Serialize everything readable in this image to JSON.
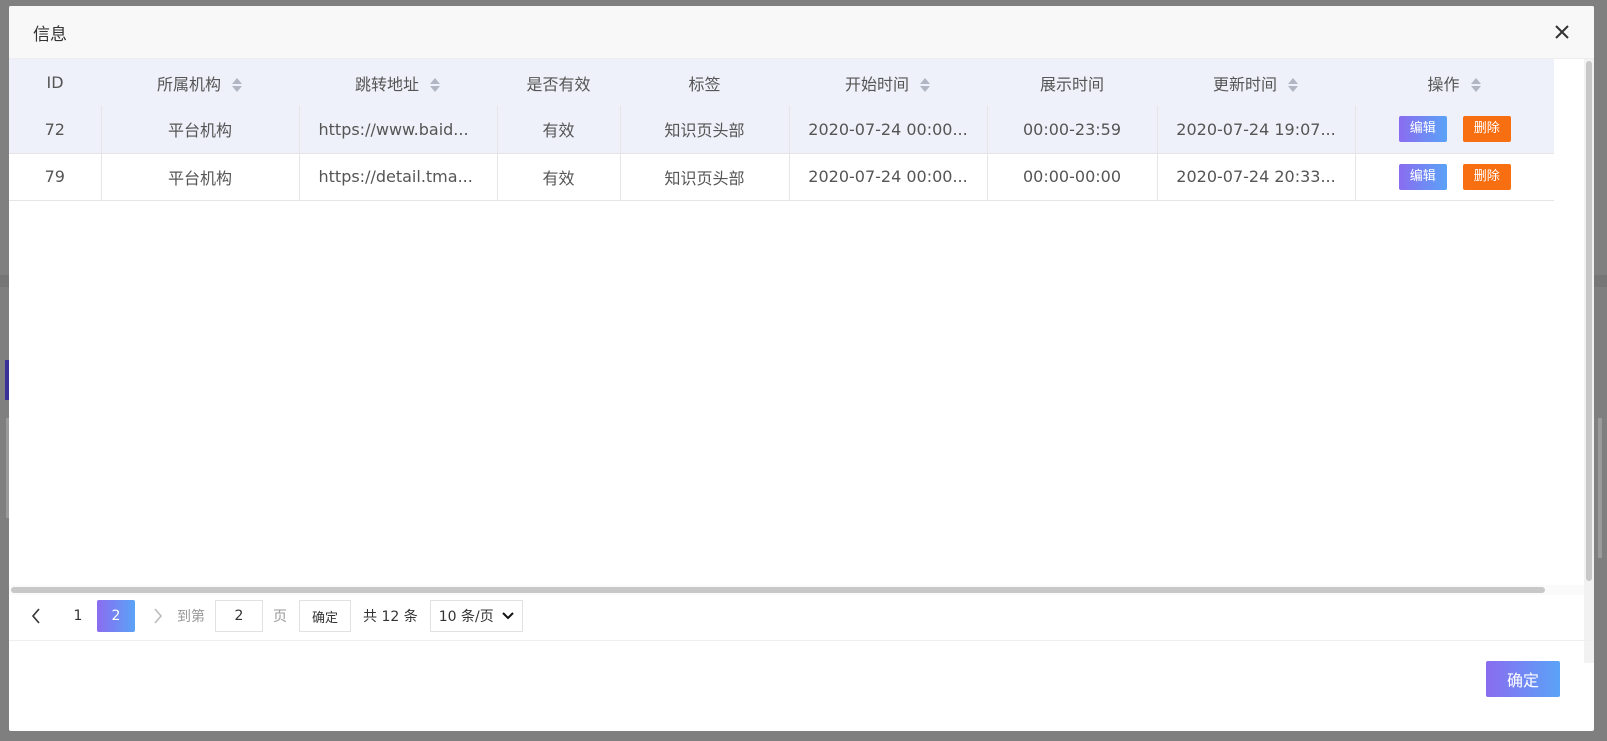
{
  "dialog": {
    "title": "信息",
    "close_icon": "close-icon",
    "ok_label": "确定"
  },
  "table": {
    "columns": [
      {
        "label": "ID",
        "sortable": false
      },
      {
        "label": "所属机构",
        "sortable": true
      },
      {
        "label": "跳转地址",
        "sortable": true
      },
      {
        "label": "是否有效",
        "sortable": false
      },
      {
        "label": "标签",
        "sortable": false
      },
      {
        "label": "开始时间",
        "sortable": true
      },
      {
        "label": "展示时间",
        "sortable": false
      },
      {
        "label": "更新时间",
        "sortable": true
      },
      {
        "label": "操作",
        "sortable": true
      }
    ],
    "rows": [
      {
        "id": "72",
        "org": "平台机构",
        "url": "https://www.baid...",
        "valid": "有效",
        "tag": "知识页头部",
        "start": "2020-07-24 00:00...",
        "show": "00:00-23:59",
        "updated": "2020-07-24 19:07...",
        "edit": "编辑",
        "delete": "删除"
      },
      {
        "id": "79",
        "org": "平台机构",
        "url": "https://detail.tma...",
        "valid": "有效",
        "tag": "知识页头部",
        "start": "2020-07-24 00:00...",
        "show": "00:00-00:00",
        "updated": "2020-07-24 20:33...",
        "edit": "编辑",
        "delete": "删除"
      }
    ]
  },
  "pagination": {
    "pages": [
      "1",
      "2"
    ],
    "current": "2",
    "goto_label": "到第",
    "goto_value": "2",
    "page_unit": "页",
    "go_label": "确定",
    "total_text": "共 12 条",
    "page_size": "10 条/页"
  },
  "colors": {
    "accent_gradient_start": "#8a6cf0",
    "accent_gradient_end": "#5aa3f7",
    "delete": "#f86f12",
    "header_bg": "#eef1f9"
  }
}
